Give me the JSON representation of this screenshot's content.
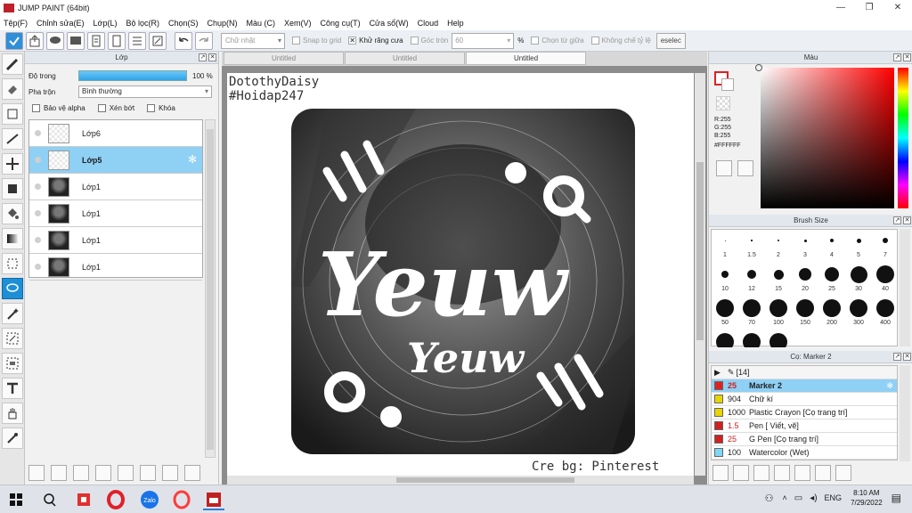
{
  "window": {
    "title": "JUMP PAINT (64bit)",
    "controls": [
      "—",
      "❐",
      "✕"
    ]
  },
  "menu": [
    "Tệp(F)",
    "Chỉnh sửa(E)",
    "Lớp(L)",
    "Bộ lọc(R)",
    "Chọn(S)",
    "Chụp(N)",
    "Màu (C)",
    "Xem(V)",
    "Công cụ(T)",
    "Cửa sổ(W)",
    "Cloud",
    "Help"
  ],
  "toolbar": {
    "shape_select": "Chữ nhật",
    "snap_to_grid": "Snap to grid",
    "antialias": "Khử răng cưa",
    "corner_round": "Góc tròn",
    "corner_value": "60",
    "percent": "%",
    "select_center": "Chọn từ giữa",
    "no_ratio": "Không chế tỷ lệ",
    "deselect": "eselec"
  },
  "layers_panel": {
    "title": "Lớp",
    "opacity_label": "Độ trong",
    "opacity_value": "100 %",
    "opacity": 1.0,
    "blend_label": "Pha trộn",
    "blend_value": "Bình thường",
    "protect_alpha": "Bảo vệ alpha",
    "clip": "Xén bớt",
    "lock": "Khóa",
    "layers": [
      {
        "name": "Lớp6",
        "thumb": "empty"
      },
      {
        "name": "Lớp5",
        "thumb": "empty",
        "active": true
      },
      {
        "name": "Lớp1",
        "thumb": "img"
      },
      {
        "name": "Lớp1",
        "thumb": "img"
      },
      {
        "name": "Lớp1",
        "thumb": "img"
      },
      {
        "name": "Lớp1",
        "thumb": "img"
      }
    ]
  },
  "tabs": [
    "Untitled",
    "Untitled",
    "Untitled"
  ],
  "canvas": {
    "line1": "DotothyDaisy",
    "line2": "#Hoidap247",
    "art_big": "Yeuw",
    "art_small": "Yeuw",
    "credit": "Cre bg: Pinterest"
  },
  "color_panel": {
    "title": "Màu",
    "r": "R:255",
    "g": "G:255",
    "b": "B:255",
    "hex": "#FFFFFF",
    "fg": "#ffffff",
    "accent": "#e02020"
  },
  "brush_panel": {
    "title": "Brush Size",
    "sizes": [
      "1",
      "1.5",
      "2",
      "3",
      "4",
      "5",
      "7",
      "10",
      "12",
      "15",
      "20",
      "25",
      "30",
      "40",
      "50",
      "70",
      "100",
      "150",
      "200",
      "300",
      "400"
    ]
  },
  "tool_panel": {
    "title": "Cọ: Marker 2",
    "group": "[14]",
    "items": [
      {
        "size": "25",
        "name": "Marker 2",
        "color": "#e02020",
        "selected": true
      },
      {
        "size": "904",
        "name": "Chữ kí",
        "color": "#e8d400"
      },
      {
        "size": "1000",
        "name": "Plastic Crayon [Cọ trang trí]",
        "color": "#e8d400"
      },
      {
        "size": "1.5",
        "name": "Pen [ Viết, vẽ]",
        "color": "#d02020"
      },
      {
        "size": "25",
        "name": "G Pen [Cọ trang trí]",
        "color": "#d02020"
      },
      {
        "size": "100",
        "name": "Watercolor (Wet)",
        "color": "#7fd7f5"
      }
    ]
  },
  "taskbar": {
    "lang": "ENG",
    "time": "8:10 AM",
    "date": "7/29/2022",
    "app_zalo": "Zalo"
  }
}
